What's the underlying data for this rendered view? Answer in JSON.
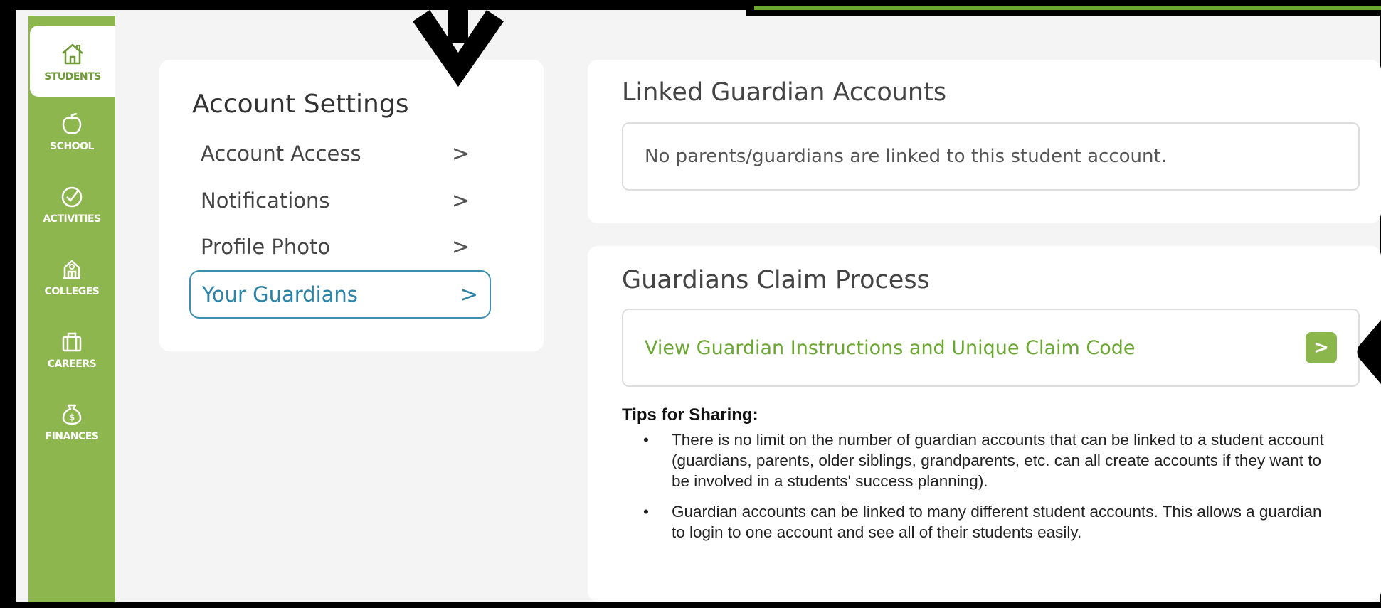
{
  "sidebar": {
    "items": [
      {
        "label": "STUDENTS",
        "icon": "home-icon",
        "active": true
      },
      {
        "label": "SCHOOL",
        "icon": "apple-icon",
        "active": false
      },
      {
        "label": "ACTIVITIES",
        "icon": "check-circle-icon",
        "active": false
      },
      {
        "label": "COLLEGES",
        "icon": "college-building-icon",
        "active": false
      },
      {
        "label": "CAREERS",
        "icon": "briefcase-icon",
        "active": false
      },
      {
        "label": "FINANCES",
        "icon": "money-bag-icon",
        "active": false
      }
    ]
  },
  "settings": {
    "title": "Account Settings",
    "items": [
      {
        "label": "Account Access",
        "chevron": ">"
      },
      {
        "label": "Notifications",
        "chevron": ">"
      },
      {
        "label": "Profile Photo",
        "chevron": ">"
      },
      {
        "label": "Your Guardians",
        "chevron": ">",
        "selected": true
      }
    ]
  },
  "linked": {
    "title": "Linked Guardian Accounts",
    "message": "No parents/guardians are linked to this student account."
  },
  "claim": {
    "title": "Guardians Claim Process",
    "link_label": "View Guardian Instructions and Unique Claim Code",
    "button_glyph": ">",
    "tips_heading": "Tips for Sharing:",
    "bullet": "•",
    "tips": [
      "There is no limit on the number of guardian accounts that can be linked to a student account (guardians, parents, older siblings, grandparents, etc. can all create accounts if they want to be involved in a students' success planning).",
      "Guardian accounts can be linked to many different student accounts. This allows a guardian to login to one account and see all of their students easily."
    ]
  },
  "colors": {
    "brand_green": "#8db74e",
    "link_green": "#6aa72f",
    "selected_blue": "#2b84a8"
  }
}
